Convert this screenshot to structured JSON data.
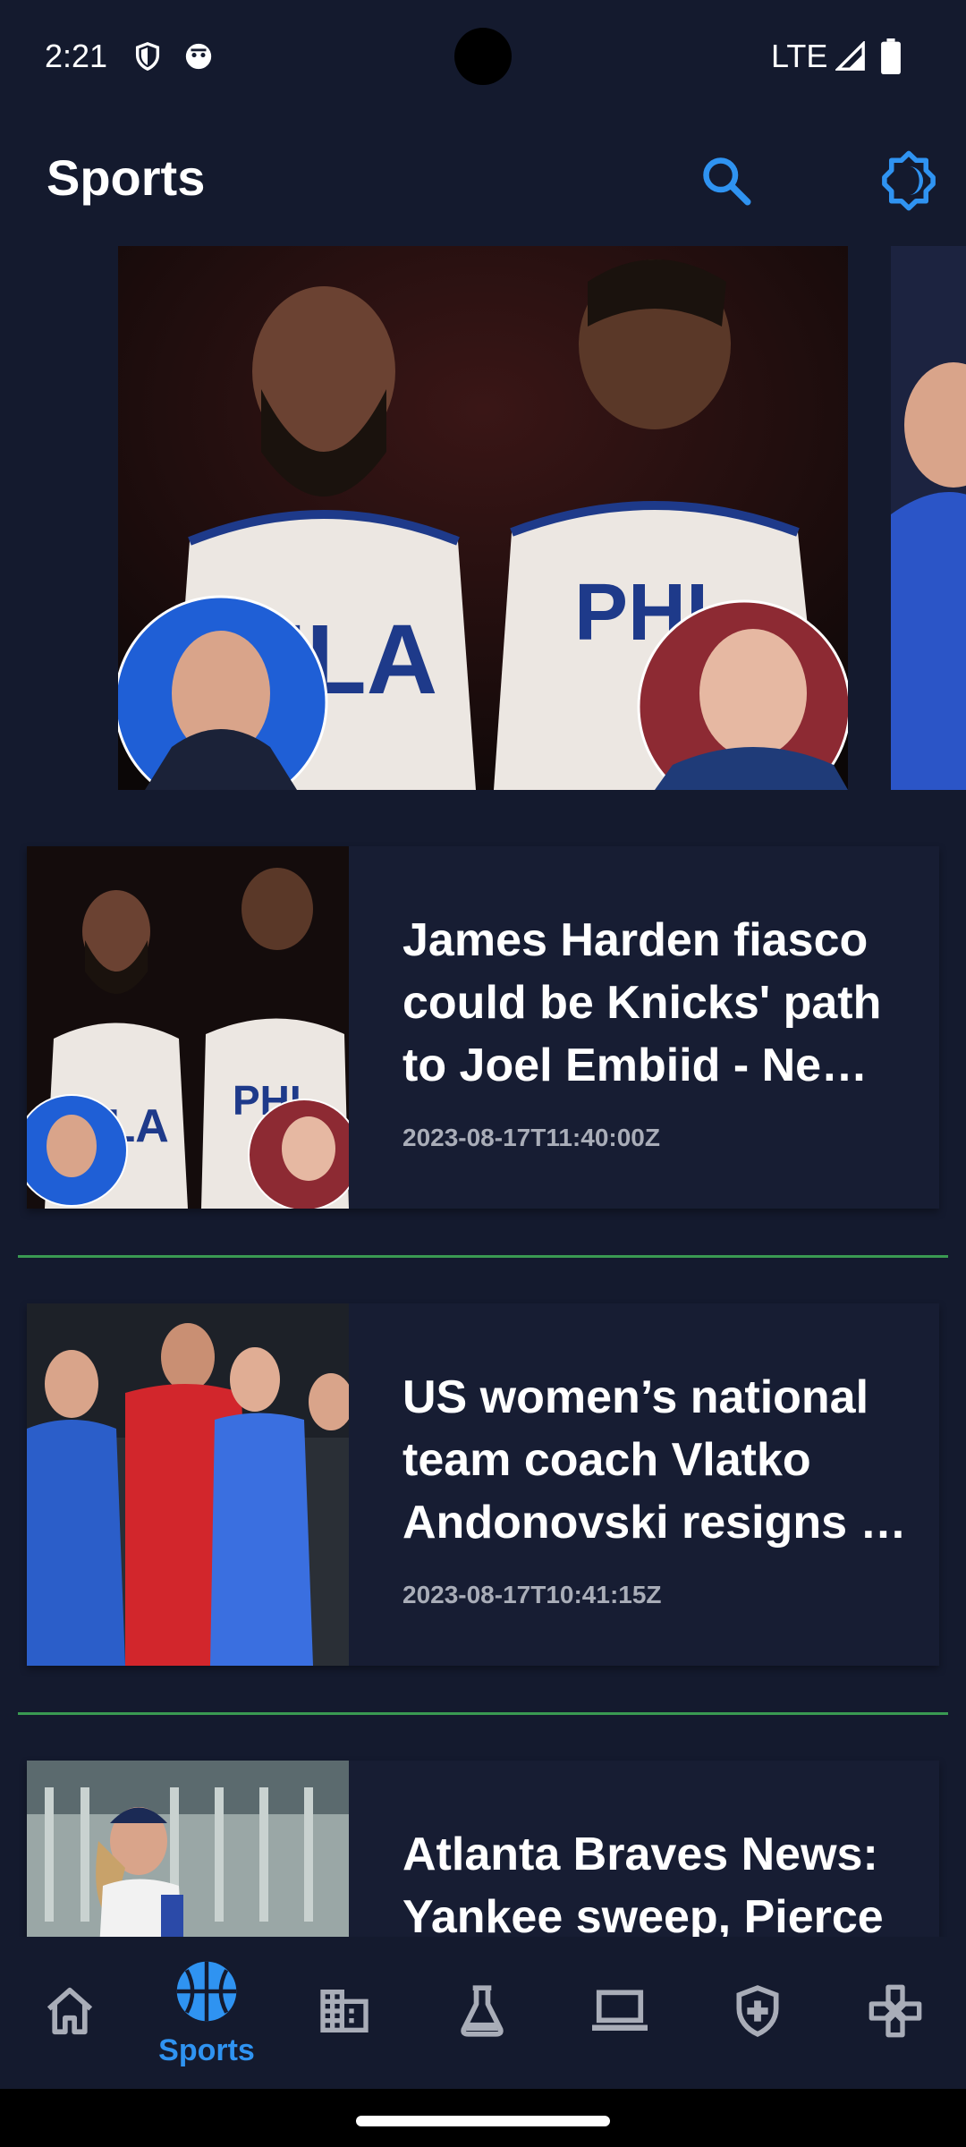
{
  "status_bar": {
    "time": "2:21",
    "network": "LTE"
  },
  "app_bar": {
    "title": "Sports",
    "search_icon": "search-icon",
    "theme_icon": "brightness-icon",
    "accent": "#2f93f1"
  },
  "carousel": {
    "items": [
      {
        "image": "harden-embiid-photo"
      },
      {
        "image": "coach-photo"
      }
    ]
  },
  "news": [
    {
      "title": "James Harden fiasco could be Knicks' path to Joel Embiid - Ne…",
      "date": "2023-08-17T11:40:00Z"
    },
    {
      "title": "US women’s national team coach Vlatko Andonovski resigns …",
      "date": "2023-08-17T10:41:15Z"
    },
    {
      "title": "Atlanta Braves News: Yankee sweep, Pierce",
      "date": ""
    }
  ],
  "bottom_nav": {
    "items": [
      {
        "icon": "home-icon",
        "label": ""
      },
      {
        "icon": "basketball-icon",
        "label": "Sports"
      },
      {
        "icon": "business-icon",
        "label": ""
      },
      {
        "icon": "science-icon",
        "label": ""
      },
      {
        "icon": "laptop-icon",
        "label": ""
      },
      {
        "icon": "health-shield-icon",
        "label": ""
      },
      {
        "icon": "gamepad-icon",
        "label": ""
      }
    ],
    "active_color": "#2f93f1",
    "inactive_color": "#a9adb8"
  }
}
